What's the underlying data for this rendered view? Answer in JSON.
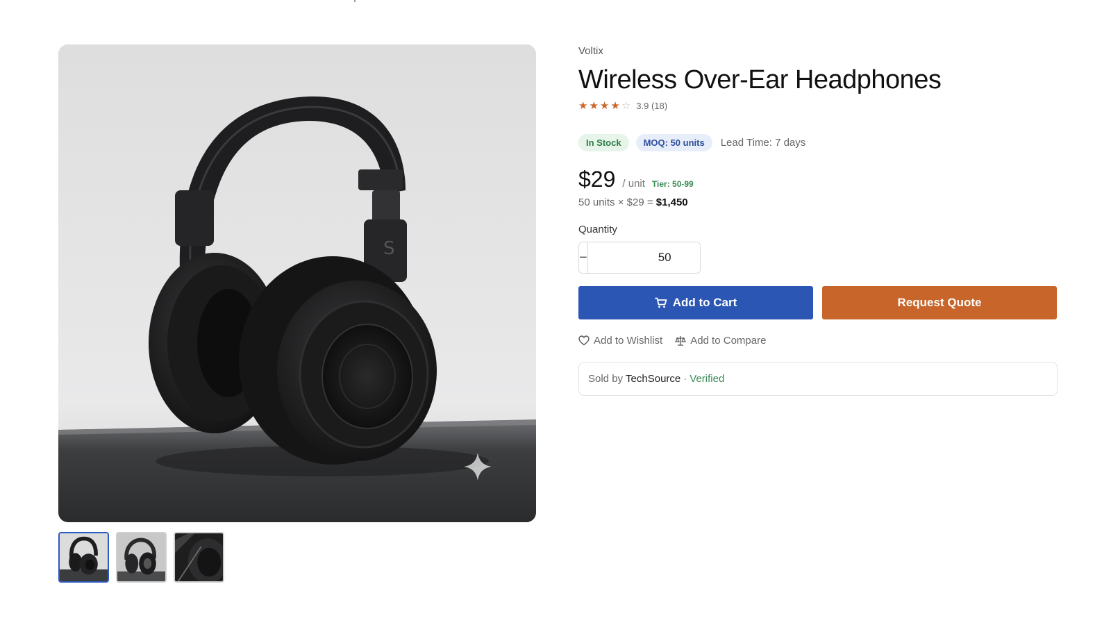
{
  "gallery": {
    "main_image_alt": "Black over-ear headphones",
    "thumbnails": [
      {
        "label": "thumb-1",
        "active": true
      },
      {
        "label": "thumb-2",
        "active": false
      },
      {
        "label": "thumb-3",
        "active": false
      }
    ]
  },
  "product": {
    "brand": "Voltix",
    "title": "Wireless Over-Ear Headphones",
    "rating": 3.9,
    "rating_text": "3.9 (18)",
    "stars": [
      1,
      1,
      1,
      1,
      0
    ],
    "badges": {
      "stock": "In Stock",
      "moq": "MOQ: 50 units"
    },
    "lead_time": "Lead Time: 7 days",
    "price": "$29",
    "per_unit": "/ unit",
    "tier": "Tier: 50-99",
    "calc_prefix": "50 units × $29 =",
    "calc_total": "$1,450"
  },
  "quantity": {
    "label": "Quantity",
    "value": "50",
    "minus": "−",
    "plus": "+"
  },
  "actions": {
    "add_to_cart": "Add to Cart",
    "request_quote": "Request Quote",
    "wishlist": "Add to Wishlist",
    "compare": "Add to Compare"
  },
  "seller": {
    "prefix": "Sold by",
    "name": "TechSource",
    "separator": "·",
    "verified": "Verified"
  },
  "colors": {
    "primary": "#2c56b3",
    "accent": "#c7652a",
    "success": "#3a8a55",
    "star": "#c9652a"
  },
  "icons": [
    "cart-icon",
    "heart-icon",
    "scale-icon",
    "star-icon",
    "sparkle-icon"
  ]
}
